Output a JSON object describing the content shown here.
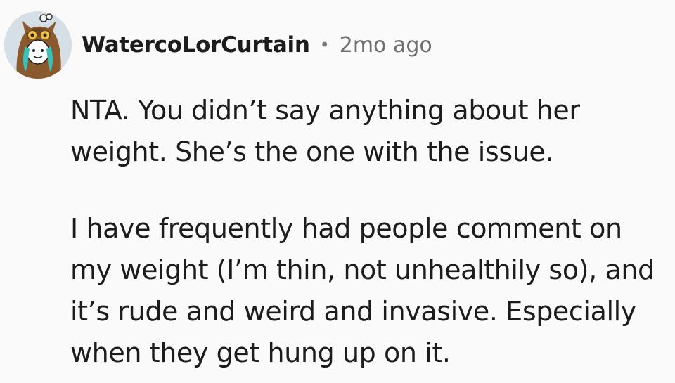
{
  "comment": {
    "author": "WatercoLorCurtain",
    "separator": "•",
    "timestamp": "2mo ago",
    "avatar_icon": "owl-hooded-avatar-icon",
    "paragraphs": [
      "NTA. You didn’t say anything about her\nweight. She’s the one with the issue.",
      "I have frequently had people comment on\nmy weight (I’m thin, not unhealthily so), and\nit’s rude and weird and invasive. Especially\nwhen they get hung up on it."
    ]
  }
}
